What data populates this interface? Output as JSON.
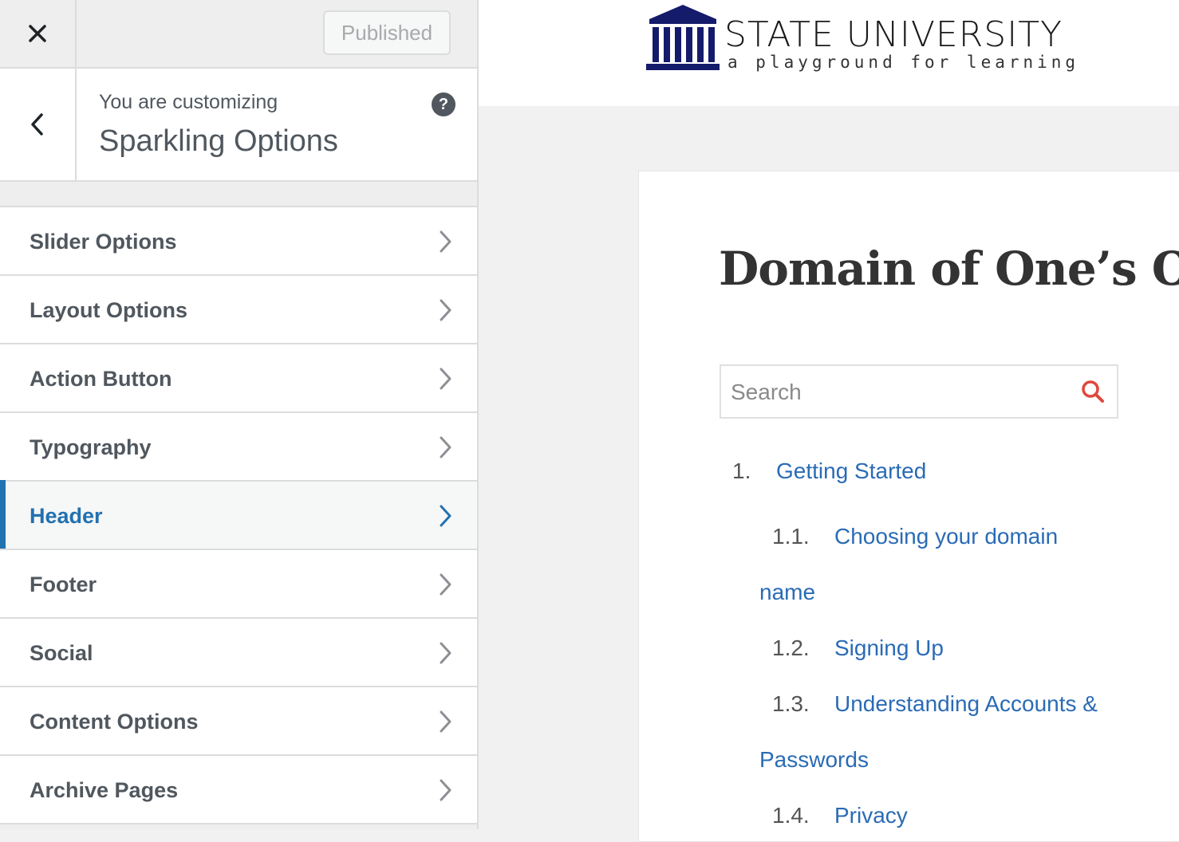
{
  "sidebar": {
    "close_icon": "close-icon",
    "publish_label": "Published",
    "back_icon": "chevron-left-icon",
    "customizing_label": "You are customizing",
    "panel_title": "Sparkling Options",
    "help_icon": "help-icon",
    "accent_color": "#2271b1",
    "items": [
      {
        "label": "Slider Options"
      },
      {
        "label": "Layout Options"
      },
      {
        "label": "Action Button"
      },
      {
        "label": "Typography"
      },
      {
        "label": "Header",
        "active": true
      },
      {
        "label": "Footer"
      },
      {
        "label": "Social"
      },
      {
        "label": "Content Options"
      },
      {
        "label": "Archive Pages"
      }
    ]
  },
  "preview": {
    "logo": {
      "name": "STATE UNIVERSITY",
      "tagline": "a playground for learning"
    },
    "page_title": "Domain of One’s Own",
    "search": {
      "placeholder": "Search"
    },
    "toc": [
      {
        "num": "1.",
        "text": "Getting Started"
      },
      {
        "num": "1.1.",
        "text": "Choosing your domain",
        "cont": "name"
      },
      {
        "num": "1.2.",
        "text": "Signing Up"
      },
      {
        "num": "1.3.",
        "text": "Understanding Accounts &",
        "cont": "Passwords"
      },
      {
        "num": "1.4.",
        "text": "Privacy"
      }
    ]
  }
}
